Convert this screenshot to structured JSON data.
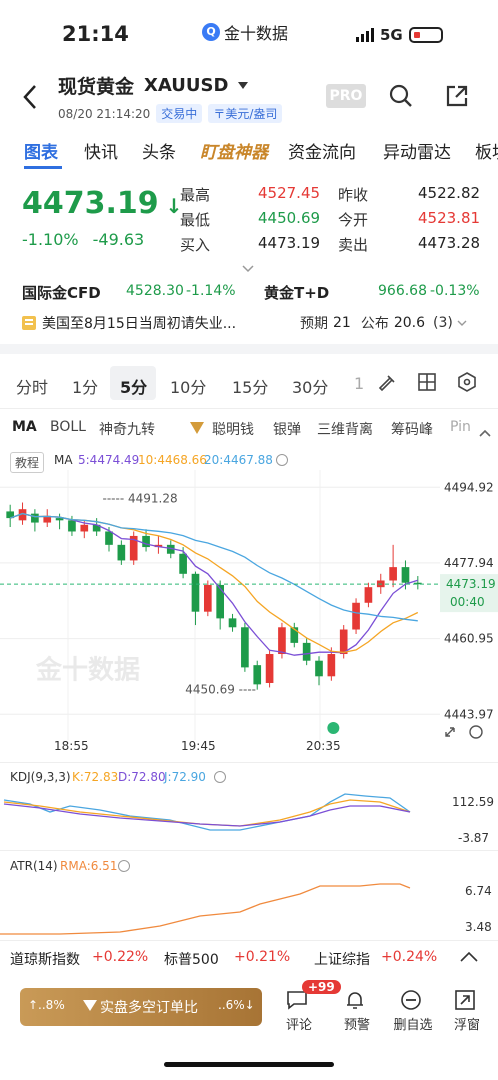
{
  "status_bar": {
    "time": "21:14",
    "app_name": "金十数据",
    "network": "5G"
  },
  "header": {
    "title": "现货黄金",
    "code": "XAUUSD",
    "datetime": "08/20 21:14:20",
    "trading_status": "交易中",
    "currency_tag": "〒美元/盎司",
    "pro_label": "PRO"
  },
  "tabs": [
    "图表",
    "快讯",
    "头条",
    "盯盘神器",
    "资金流向",
    "异动雷达",
    "板块"
  ],
  "quote": {
    "price": "4473.19",
    "change_pct": "-1.10%",
    "change": "-49.63",
    "high_label": "最高",
    "high": "4527.45",
    "low_label": "最低",
    "low": "4450.69",
    "buy_label": "买入",
    "buy": "4473.19",
    "prev_close_label": "昨收",
    "prev_close": "4522.82",
    "open_label": "今开",
    "open": "4523.81",
    "sell_label": "卖出",
    "sell": "4473.28"
  },
  "related": {
    "cfd_label": "国际金CFD",
    "cfd_price": "4528.30",
    "cfd_chg": "-1.14%",
    "td_label": "黄金T+D",
    "td_price": "966.68",
    "td_chg": "-0.13%"
  },
  "event": {
    "text": "美国至8月15日当周初请失业...",
    "expected_label": "预期",
    "expected": "21",
    "actual_label": "公布",
    "actual": "20.6",
    "count": "(3)"
  },
  "periods": [
    "分时",
    "1分",
    "5分",
    "10分",
    "15分",
    "30分",
    "1"
  ],
  "active_period": "5分",
  "indicator_tabs": [
    "MA",
    "BOLL",
    "神奇九转",
    "聪明钱",
    "银弹",
    "三维背离",
    "筹码峰",
    "Pin"
  ],
  "ma_legend": {
    "tutorial": "教程",
    "label": "MA",
    "ma5": "5:4474.49",
    "ma10": "10:4468.66",
    "ma20": "20:4467.88"
  },
  "colors": {
    "up": "#e53935",
    "down": "#1e9b4a",
    "ma5": "#7b4fd6",
    "ma10": "#f5a524",
    "ma20": "#4aa6e0",
    "accent": "#2f6fe0"
  },
  "chart_data": [
    {
      "type": "candlestick",
      "title": "",
      "y_ticks": [
        "4494.92",
        "4477.94",
        "4460.95",
        "4443.97"
      ],
      "x_ticks": [
        "18:55",
        "19:45",
        "20:35"
      ],
      "current_price_tag": "4473.19",
      "countdown": "00:40",
      "annotations": [
        {
          "label": "4491.28"
        },
        {
          "label": "4450.69"
        }
      ],
      "watermark": "金十数据",
      "ylim": [
        4440,
        4497
      ],
      "candles": [
        {
          "o": 4489.5,
          "c": 4488.0,
          "h": 4491.0,
          "l": 4486.0
        },
        {
          "o": 4487.5,
          "c": 4490.0,
          "h": 4491.5,
          "l": 4486.5
        },
        {
          "o": 4489.0,
          "c": 4487.0,
          "h": 4490.0,
          "l": 4485.0
        },
        {
          "o": 4487.0,
          "c": 4488.5,
          "h": 4490.0,
          "l": 4486.0
        },
        {
          "o": 4488.0,
          "c": 4487.5,
          "h": 4489.0,
          "l": 4485.5
        },
        {
          "o": 4487.5,
          "c": 4485.0,
          "h": 4488.5,
          "l": 4484.0
        },
        {
          "o": 4485.0,
          "c": 4486.5,
          "h": 4487.5,
          "l": 4483.5
        },
        {
          "o": 4486.5,
          "c": 4485.0,
          "h": 4488.0,
          "l": 4484.0
        },
        {
          "o": 4485.0,
          "c": 4482.0,
          "h": 4486.0,
          "l": 4480.5
        },
        {
          "o": 4482.0,
          "c": 4478.5,
          "h": 4483.0,
          "l": 4477.5
        },
        {
          "o": 4478.5,
          "c": 4484.0,
          "h": 4485.0,
          "l": 4477.5
        },
        {
          "o": 4484.0,
          "c": 4481.5,
          "h": 4485.5,
          "l": 4480.5
        },
        {
          "o": 4481.5,
          "c": 4482.0,
          "h": 4484.0,
          "l": 4480.0
        },
        {
          "o": 4482.0,
          "c": 4480.0,
          "h": 4483.0,
          "l": 4479.0
        },
        {
          "o": 4480.0,
          "c": 4475.5,
          "h": 4481.5,
          "l": 4474.5
        },
        {
          "o": 4475.5,
          "c": 4467.0,
          "h": 4476.0,
          "l": 4464.0
        },
        {
          "o": 4467.0,
          "c": 4473.0,
          "h": 4474.0,
          "l": 4466.0
        },
        {
          "o": 4473.0,
          "c": 4465.5,
          "h": 4474.0,
          "l": 4463.0
        },
        {
          "o": 4465.5,
          "c": 4463.5,
          "h": 4466.5,
          "l": 4462.5
        },
        {
          "o": 4463.5,
          "c": 4454.5,
          "h": 4464.5,
          "l": 4453.5
        },
        {
          "o": 4455.0,
          "c": 4450.69,
          "h": 4456.0,
          "l": 4449.5
        },
        {
          "o": 4451.0,
          "c": 4457.5,
          "h": 4458.5,
          "l": 4450.0
        },
        {
          "o": 4457.5,
          "c": 4463.5,
          "h": 4464.5,
          "l": 4456.5
        },
        {
          "o": 4463.5,
          "c": 4460.0,
          "h": 4464.5,
          "l": 4459.0
        },
        {
          "o": 4460.0,
          "c": 4456.0,
          "h": 4461.0,
          "l": 4455.0
        },
        {
          "o": 4456.0,
          "c": 4452.5,
          "h": 4457.0,
          "l": 4450.5
        },
        {
          "o": 4452.5,
          "c": 4457.5,
          "h": 4459.0,
          "l": 4451.5
        },
        {
          "o": 4457.5,
          "c": 4463.0,
          "h": 4464.0,
          "l": 4456.5
        },
        {
          "o": 4463.0,
          "c": 4469.0,
          "h": 4470.0,
          "l": 4462.0
        },
        {
          "o": 4469.0,
          "c": 4472.5,
          "h": 4473.5,
          "l": 4468.0
        },
        {
          "o": 4472.5,
          "c": 4474.0,
          "h": 4475.5,
          "l": 4471.0
        },
        {
          "o": 4474.0,
          "c": 4477.0,
          "h": 4482.0,
          "l": 4472.5
        },
        {
          "o": 4477.0,
          "c": 4473.5,
          "h": 4478.5,
          "l": 4472.0
        },
        {
          "o": 4473.5,
          "c": 4473.19,
          "h": 4475.0,
          "l": 4472.0
        }
      ]
    },
    {
      "type": "line",
      "title": "KDJ(9,3,3)",
      "series_labels": [
        "K:72.83",
        "D:72.80",
        "J:72.90"
      ],
      "y_ticks": [
        "112.59",
        "-3.87"
      ]
    },
    {
      "type": "line",
      "title": "ATR(14)",
      "series_labels": [
        "RMA:6.51"
      ],
      "y_ticks": [
        "6.74",
        "3.48"
      ]
    }
  ],
  "bottom_ticker": [
    {
      "name": "道琼斯指数",
      "chg": "+0.22%"
    },
    {
      "name": "标普500",
      "chg": "+0.21%"
    },
    {
      "name": "上证综指",
      "chg": "+0.24%"
    }
  ],
  "bottom_bar": {
    "gold_left": "↑..8%",
    "gold_text": "实盘多空订单比",
    "gold_right": "..6%↓",
    "comment_badge": "+99",
    "comment": "评论",
    "alert": "预警",
    "remove_watch": "删自选",
    "float_window": "浮窗"
  }
}
